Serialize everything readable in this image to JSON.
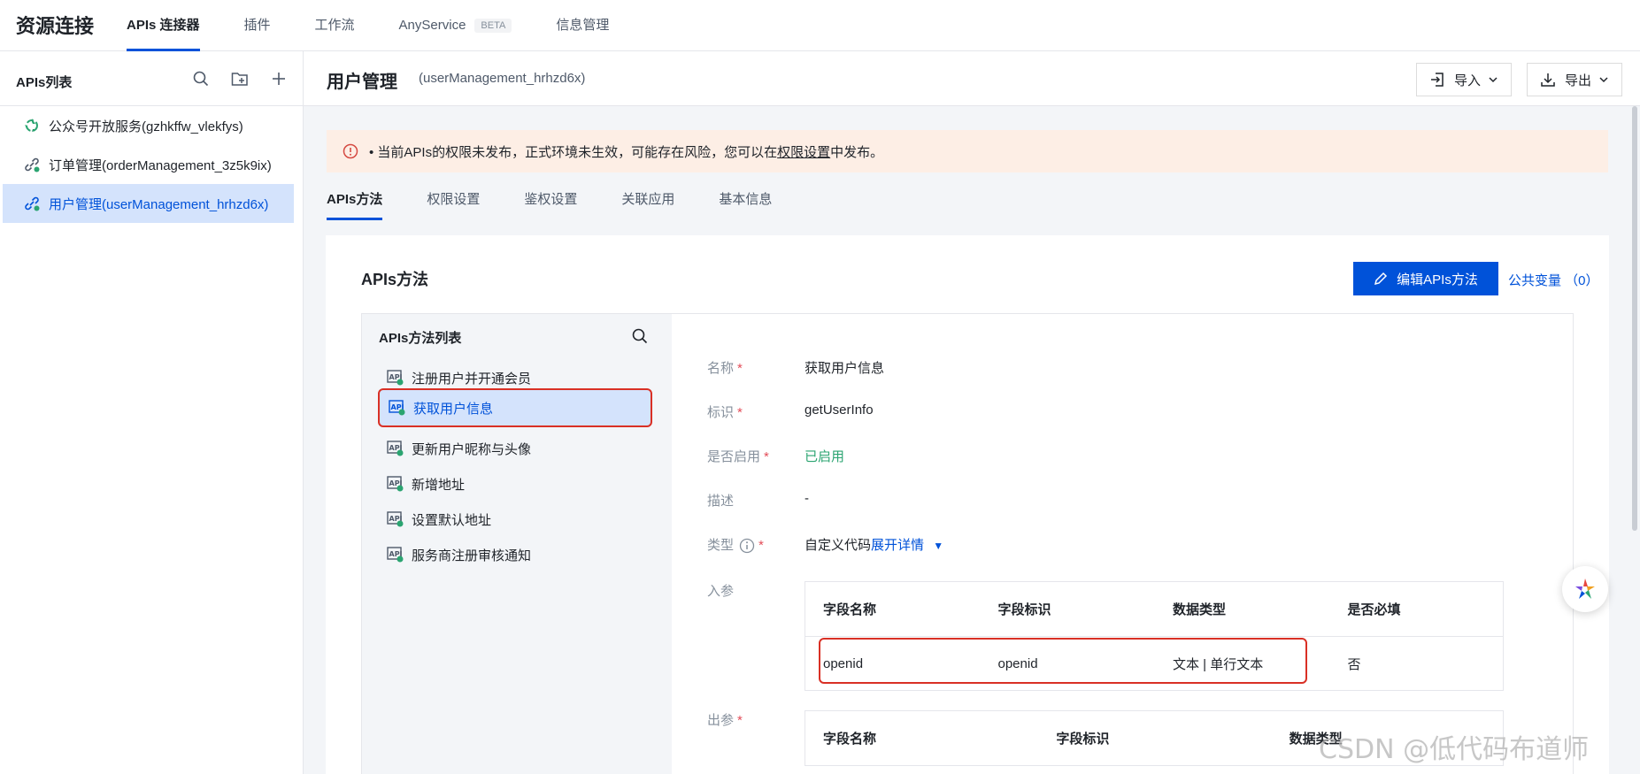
{
  "brand": "资源连接",
  "top_nav": [
    {
      "label": "APIs 连接器",
      "active": true
    },
    {
      "label": "插件",
      "active": false
    },
    {
      "label": "工作流",
      "active": false
    },
    {
      "label": "AnyService",
      "badge": "BETA",
      "active": false
    },
    {
      "label": "信息管理",
      "active": false
    }
  ],
  "sidebar": {
    "title": "APIs列表",
    "items": [
      {
        "label": "公众号开放服务(gzhkffw_vlekfys)",
        "icon": "recycle-icon",
        "active": false
      },
      {
        "label": "订单管理(orderManagement_3z5k9ix)",
        "icon": "link-icon",
        "active": false
      },
      {
        "label": "用户管理(userManagement_hrhzd6x)",
        "icon": "link-icon",
        "active": true
      }
    ]
  },
  "header": {
    "title": "用户管理",
    "subtitle": "(userManagement_hrhzd6x)",
    "import_label": "导入",
    "export_label": "导出"
  },
  "alert": {
    "prefix": "• 当前APIs的权限未发布，正式环境未生效，可能存在风险，您可以在",
    "link": "权限设置",
    "suffix": "中发布。"
  },
  "tabs": [
    "APIs方法",
    "权限设置",
    "鉴权设置",
    "关联应用",
    "基本信息"
  ],
  "panel": {
    "title": "APIs方法",
    "edit_button": "编辑APIs方法",
    "public_vars": "公共变量 （0）"
  },
  "methods": {
    "title": "APIs方法列表",
    "items": [
      {
        "label": "注册用户并开通会员",
        "active": false
      },
      {
        "label": "获取用户信息",
        "active": true
      },
      {
        "label": "更新用户昵称与头像",
        "active": false
      },
      {
        "label": "新增地址",
        "active": false
      },
      {
        "label": "设置默认地址",
        "active": false
      },
      {
        "label": "服务商注册审核通知",
        "active": false
      }
    ]
  },
  "detail": {
    "name_label": "名称",
    "name_value": "获取用户信息",
    "id_label": "标识",
    "id_value": "getUserInfo",
    "enabled_label": "是否启用",
    "enabled_value": "已启用",
    "desc_label": "描述",
    "desc_value": "-",
    "type_label": "类型",
    "type_value": "自定义代码",
    "type_link": "展开详情",
    "input_label": "入参",
    "output_label": "出参",
    "input_table": {
      "headers": [
        "字段名称",
        "字段标识",
        "数据类型",
        "是否必填"
      ],
      "rows": [
        [
          "openid",
          "openid",
          "文本 | 单行文本",
          "否"
        ]
      ]
    },
    "output_table": {
      "headers": [
        "字段名称",
        "字段标识",
        "数据类型"
      ]
    }
  },
  "watermark": "CSDN @低代码布道师",
  "colors": {
    "primary": "#0052d9",
    "alert_bg": "#fdeee5",
    "success": "#2ba471",
    "required": "#e34d59",
    "highlight": "#d93025"
  }
}
